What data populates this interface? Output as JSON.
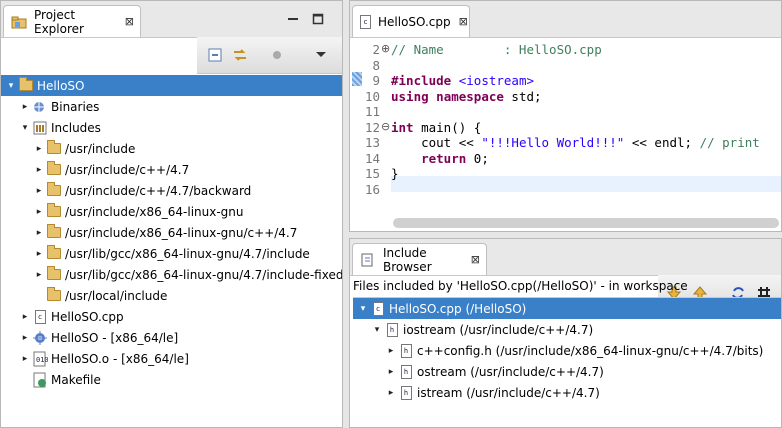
{
  "project_explorer": {
    "tab_title": "Project Explorer",
    "close_glyph": "⊠",
    "items": [
      {
        "label": "HelloSO",
        "icon": "project-icon",
        "twisty": "▾",
        "selected": true
      },
      {
        "label": "Binaries",
        "icon": "binaries-icon",
        "twisty": "▸"
      },
      {
        "label": "Includes",
        "icon": "includes-icon",
        "twisty": "▾"
      },
      {
        "label": "/usr/include",
        "icon": "include-folder-icon",
        "twisty": "▸"
      },
      {
        "label": "/usr/include/c++/4.7",
        "icon": "include-folder-icon",
        "twisty": "▸"
      },
      {
        "label": "/usr/include/c++/4.7/backward",
        "icon": "include-folder-icon",
        "twisty": "▸"
      },
      {
        "label": "/usr/include/x86_64-linux-gnu",
        "icon": "include-folder-icon",
        "twisty": "▸"
      },
      {
        "label": "/usr/include/x86_64-linux-gnu/c++/4.7",
        "icon": "include-folder-icon",
        "twisty": "▸"
      },
      {
        "label": "/usr/lib/gcc/x86_64-linux-gnu/4.7/include",
        "icon": "include-folder-icon",
        "twisty": "▸"
      },
      {
        "label": "/usr/lib/gcc/x86_64-linux-gnu/4.7/include-fixed",
        "icon": "include-folder-icon",
        "twisty": "▸"
      },
      {
        "label": "/usr/local/include",
        "icon": "include-folder-icon",
        "twisty": ""
      },
      {
        "label": "HelloSO.cpp",
        "icon": "cpp-file-icon",
        "twisty": "▸"
      },
      {
        "label": "HelloSO - [x86_64/le]",
        "icon": "executable-icon",
        "twisty": "▸"
      },
      {
        "label": "HelloSO.o - [x86_64/le]",
        "icon": "object-file-icon",
        "twisty": "▸"
      },
      {
        "label": "Makefile",
        "icon": "makefile-icon",
        "twisty": ""
      }
    ]
  },
  "editor": {
    "tab_title": "HelloSO.cpp",
    "lines": [
      {
        "num": "2",
        "marker": "⊕",
        "parts": [
          {
            "t": "// Name        : HelloSO.cpp",
            "c": "cm"
          }
        ]
      },
      {
        "num": "8",
        "marker": "",
        "parts": []
      },
      {
        "num": "9",
        "marker": "",
        "parts": [
          {
            "t": "#include",
            "c": "kw"
          },
          {
            "t": " ",
            "c": ""
          },
          {
            "t": "<iostream>",
            "c": "inc"
          }
        ]
      },
      {
        "num": "10",
        "marker": "",
        "parts": [
          {
            "t": "using",
            "c": "kw"
          },
          {
            "t": " ",
            "c": ""
          },
          {
            "t": "namespace",
            "c": "kw"
          },
          {
            "t": " std;",
            "c": ""
          }
        ]
      },
      {
        "num": "11",
        "marker": "",
        "parts": []
      },
      {
        "num": "12",
        "marker": "⊖",
        "parts": [
          {
            "t": "int",
            "c": "kw"
          },
          {
            "t": " main() {",
            "c": ""
          }
        ]
      },
      {
        "num": "13",
        "marker": "",
        "parts": [
          {
            "t": "    cout << ",
            "c": ""
          },
          {
            "t": "\"!!!Hello World!!!\"",
            "c": "str"
          },
          {
            "t": " << endl; ",
            "c": ""
          },
          {
            "t": "// print",
            "c": "cm"
          }
        ]
      },
      {
        "num": "14",
        "marker": "",
        "parts": [
          {
            "t": "    ",
            "c": ""
          },
          {
            "t": "return",
            "c": "kw"
          },
          {
            "t": " 0;",
            "c": ""
          }
        ]
      },
      {
        "num": "15",
        "marker": "",
        "parts": [
          {
            "t": "}",
            "c": ""
          }
        ]
      },
      {
        "num": "16",
        "marker": "",
        "parts": []
      }
    ]
  },
  "include_browser": {
    "tab_title": "Include Browser",
    "close_glyph": "⊠",
    "status": "Files included by 'HelloSO.cpp(/HelloSO)' - in workspace",
    "items": [
      {
        "label": "HelloSO.cpp (/HelloSO)",
        "icon": "cpp-file-icon",
        "twisty": "▾",
        "selected": true,
        "level": 0
      },
      {
        "label": "iostream (/usr/include/c++/4.7)",
        "icon": "header-file-icon",
        "twisty": "▾",
        "level": 1
      },
      {
        "label": "c++config.h (/usr/include/x86_64-linux-gnu/c++/4.7/bits)",
        "icon": "header-file-icon",
        "twisty": "▸",
        "level": 2
      },
      {
        "label": "ostream (/usr/include/c++/4.7)",
        "icon": "header-file-icon",
        "twisty": "▸",
        "level": 2
      },
      {
        "label": "istream (/usr/include/c++/4.7)",
        "icon": "header-file-icon",
        "twisty": "▸",
        "level": 2
      }
    ]
  },
  "colors": {
    "selection": "#3a80c8",
    "keyword": "#7f0055",
    "comment": "#3f7f5f",
    "string": "#2a00ff"
  }
}
